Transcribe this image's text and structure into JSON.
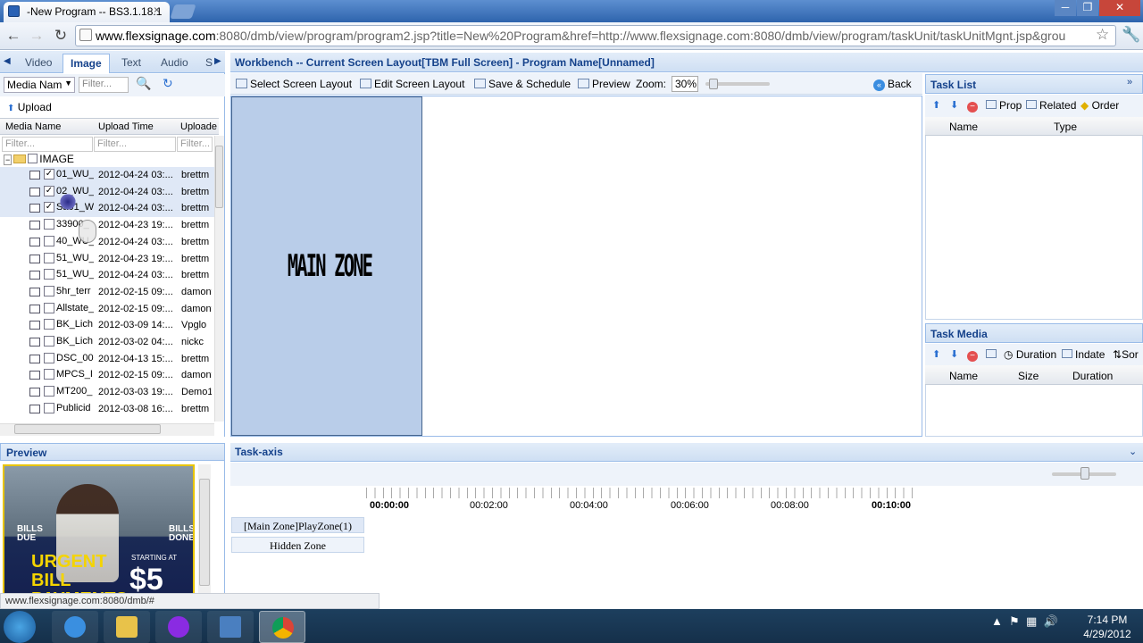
{
  "browser": {
    "tab_title": "-New Program -- BS3.1.18.1",
    "tab_close": "×",
    "url_host": "www.flexsignage.com",
    "url_rest": ":8080/dmb/view/program/program2.jsp?title=New%20Program&href=http://www.flexsignage.com:8080/dmb/view/program/taskUnit/taskUnitMgnt.jsp&grou",
    "back": "←",
    "forward": "→",
    "reload": "↻",
    "star": "☆",
    "wrench": "🔧",
    "win_min": "─",
    "win_max": "❐",
    "win_close": "✕"
  },
  "left_tabs": [
    "Video",
    "Image",
    "Text",
    "Audio",
    "S"
  ],
  "left_toolbar": {
    "select_value": "Media Nam",
    "filter_placeholder": "Filter...",
    "upload_label": "Upload"
  },
  "grid": {
    "headers": [
      "Media Name",
      "Upload Time",
      "Uploade"
    ],
    "filter_placeholder": "Filter...",
    "root_label": "IMAGE",
    "rows": [
      {
        "name": "01_WU_",
        "time": "2012-04-24 03:...",
        "user": "brettm",
        "checked": "✓"
      },
      {
        "name": "02_WU_",
        "time": "2012-04-24 03:...",
        "user": "brettm",
        "checked": "✓"
      },
      {
        "name": "Sa01_W",
        "time": "2012-04-24 03:...",
        "user": "brettm",
        "checked": "✓"
      },
      {
        "name": "33900_",
        "time": "2012-04-23 19:...",
        "user": "brettm",
        "checked": ""
      },
      {
        "name": "40_WU_",
        "time": "2012-04-24 03:...",
        "user": "brettm",
        "checked": ""
      },
      {
        "name": "51_WU_",
        "time": "2012-04-23 19:...",
        "user": "brettm",
        "checked": ""
      },
      {
        "name": "51_WU_",
        "time": "2012-04-24 03:...",
        "user": "brettm",
        "checked": ""
      },
      {
        "name": "5hr_terr",
        "time": "2012-02-15 09:...",
        "user": "damont",
        "checked": ""
      },
      {
        "name": "Allstate_",
        "time": "2012-02-15 09:...",
        "user": "damont",
        "checked": ""
      },
      {
        "name": "BK_Lich",
        "time": "2012-03-09 14:...",
        "user": "Vpglo",
        "checked": ""
      },
      {
        "name": "BK_Lich",
        "time": "2012-03-02 04:...",
        "user": "nickc",
        "checked": ""
      },
      {
        "name": "DSC_00",
        "time": "2012-04-13 15:...",
        "user": "brettm",
        "checked": ""
      },
      {
        "name": "MPCS_I",
        "time": "2012-02-15 09:...",
        "user": "damont",
        "checked": ""
      },
      {
        "name": "MT200_",
        "time": "2012-03-03 19:...",
        "user": "Demo1",
        "checked": ""
      },
      {
        "name": "Publicid",
        "time": "2012-03-08 16:...",
        "user": "brettm",
        "checked": ""
      }
    ]
  },
  "preview": {
    "title": "Preview",
    "bills_due": "BILLS DUE",
    "bills_done": "BILLS DONE",
    "urgent": "URGENT BILL PAYMENTS",
    "starting_at": "STARTING AT",
    "price": "$5"
  },
  "workbench": {
    "title": "Workbench -- Current Screen Layout[TBM Full Screen] - Program Name[Unnamed]",
    "select_layout": "Select Screen Layout",
    "edit_layout": "Edit Screen Layout",
    "save_schedule": "Save & Schedule",
    "preview": "Preview",
    "zoom_label": "Zoom:",
    "zoom_value": "30%",
    "back": "Back",
    "zone_label": "MAIN ZONE"
  },
  "task_list": {
    "title": "Task List",
    "prop": "Prop",
    "related": "Related",
    "order": "Order",
    "col_name": "Name",
    "col_type": "Type"
  },
  "task_media": {
    "title": "Task Media",
    "duration_btn": "Duration",
    "indate": "Indate",
    "sort": "Sor",
    "col_name": "Name",
    "col_size": "Size",
    "col_duration": "Duration"
  },
  "task_axis": {
    "title": "Task-axis",
    "times": [
      "00:00:00",
      "00:02:00",
      "00:04:00",
      "00:06:00",
      "00:08:00",
      "00:10:00"
    ],
    "zones": [
      "[Main Zone]PlayZone(1)",
      "Hidden Zone"
    ]
  },
  "status_url": "www.flexsignage.com:8080/dmb/#",
  "taskbar": {
    "time": "7:14 PM",
    "date": "4/29/2012"
  }
}
